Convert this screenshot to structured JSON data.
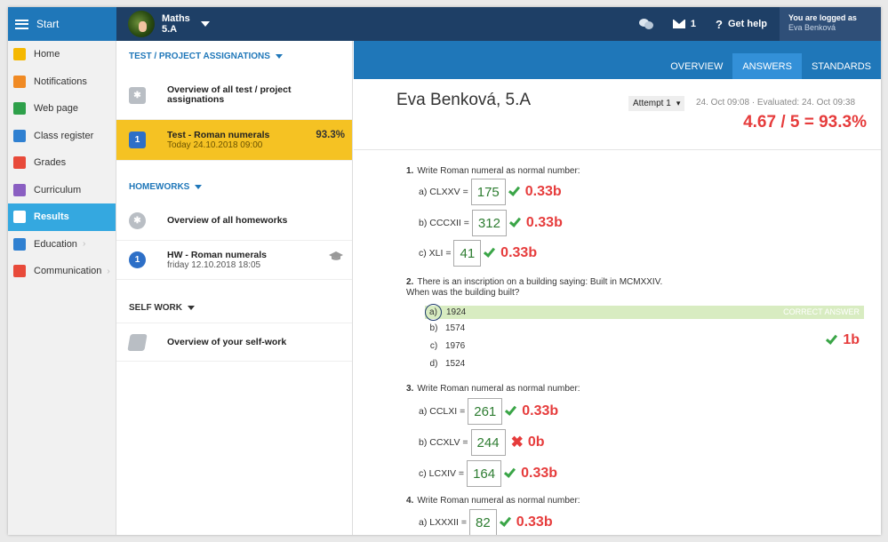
{
  "topbar": {
    "start": "Start",
    "subject_name": "Maths",
    "subject_class": "5.A",
    "messages_count": "1",
    "help": "Get help",
    "logged_line1": "You are logged as",
    "logged_line2": "Eva Benková"
  },
  "sidebar": {
    "items": [
      {
        "label": "Home",
        "icon": "star-icon",
        "color": "#f5b800"
      },
      {
        "label": "Notifications",
        "icon": "mail-icon",
        "color": "#f08a24"
      },
      {
        "label": "Web page",
        "icon": "house-icon",
        "color": "#2ea04a"
      },
      {
        "label": "Class register",
        "icon": "book-icon",
        "color": "#2f80d1"
      },
      {
        "label": "Grades",
        "icon": "grades-icon",
        "color": "#e84a3a"
      },
      {
        "label": "Curriculum",
        "icon": "curriculum-icon",
        "color": "#8a5fc2"
      },
      {
        "label": "Results",
        "icon": "bar-chart-icon",
        "color": "#ffffff",
        "active": true
      },
      {
        "label": "Education",
        "icon": "education-icon",
        "color": "#2f80d1",
        "arrow": "›"
      },
      {
        "label": "Communication",
        "icon": "chat-icon",
        "color": "#e84a3a",
        "arrow": "›"
      }
    ]
  },
  "middle": {
    "tests_header": "TEST / PROJECT ASSIGNATIONS",
    "tests_overview": "Overview of all test / project assignations",
    "test_badge": "1",
    "test_title": "Test - Roman numerals",
    "test_date": "Today 24.10.2018 09:00",
    "test_percent": "93.3%",
    "homeworks_header": "HOMEWORKS",
    "hw_overview": "Overview of all homeworks",
    "hw_badge": "1",
    "hw_title": "HW - Roman numerals",
    "hw_date": "friday 12.10.2018 18:05",
    "selfwork_header": "SELF WORK",
    "selfwork_overview": "Overview of your self-work"
  },
  "tabs": [
    "OVERVIEW",
    "ANSWERS",
    "STANDARDS"
  ],
  "active_tab": "ANSWERS",
  "result": {
    "student": "Eva Benková, 5.A",
    "attempt": "Attempt 1",
    "dates": "24. Oct 09:08 · Evaluated: 24. Oct 09:38",
    "score": "4.67 / 5 = 93.3%"
  },
  "questions": {
    "q1": {
      "num": "1.",
      "text": "Write Roman numeral as normal number:",
      "answers": [
        {
          "label": "a) CLXXV =",
          "value": "175",
          "points": "0.33b",
          "correct": true
        },
        {
          "label": "b) CCCXII =",
          "value": "312",
          "points": "0.33b",
          "correct": true
        },
        {
          "label": "c) XLI =",
          "value": "41",
          "points": "0.33b",
          "correct": true
        }
      ]
    },
    "q2": {
      "num": "2.",
      "text1": "There is an inscription on a building saying: Built in MCMXXIV.",
      "text2": "When was the building built?",
      "choices": [
        {
          "letter": "a)",
          "value": "1924"
        },
        {
          "letter": "b)",
          "value": "1574"
        },
        {
          "letter": "c)",
          "value": "1976"
        },
        {
          "letter": "d)",
          "value": "1524"
        }
      ],
      "correct_label": "CORRECT ANSWER",
      "points": "1b"
    },
    "q3": {
      "num": "3.",
      "text": "Write Roman numeral as normal number:",
      "answers": [
        {
          "label": "a) CCLXI =",
          "value": "261",
          "points": "0.33b",
          "correct": true
        },
        {
          "label": "b) CCXLV =",
          "value": "244",
          "points": "0b",
          "correct": false
        },
        {
          "label": "c) LCXIV =",
          "value": "164",
          "points": "0.33b",
          "correct": true
        }
      ]
    },
    "q4": {
      "num": "4.",
      "text": "Write Roman numeral as normal number:",
      "answers": [
        {
          "label": "a) LXXXII =",
          "value": "82",
          "points": "0.33b",
          "correct": true
        }
      ]
    }
  },
  "colors": {
    "topbar": "#1e3f66",
    "accent": "#1f77b9",
    "active": "#34a8e0",
    "selected": "#f5c223",
    "score_red": "#e63c3c",
    "correct_green": "#3aa547"
  }
}
